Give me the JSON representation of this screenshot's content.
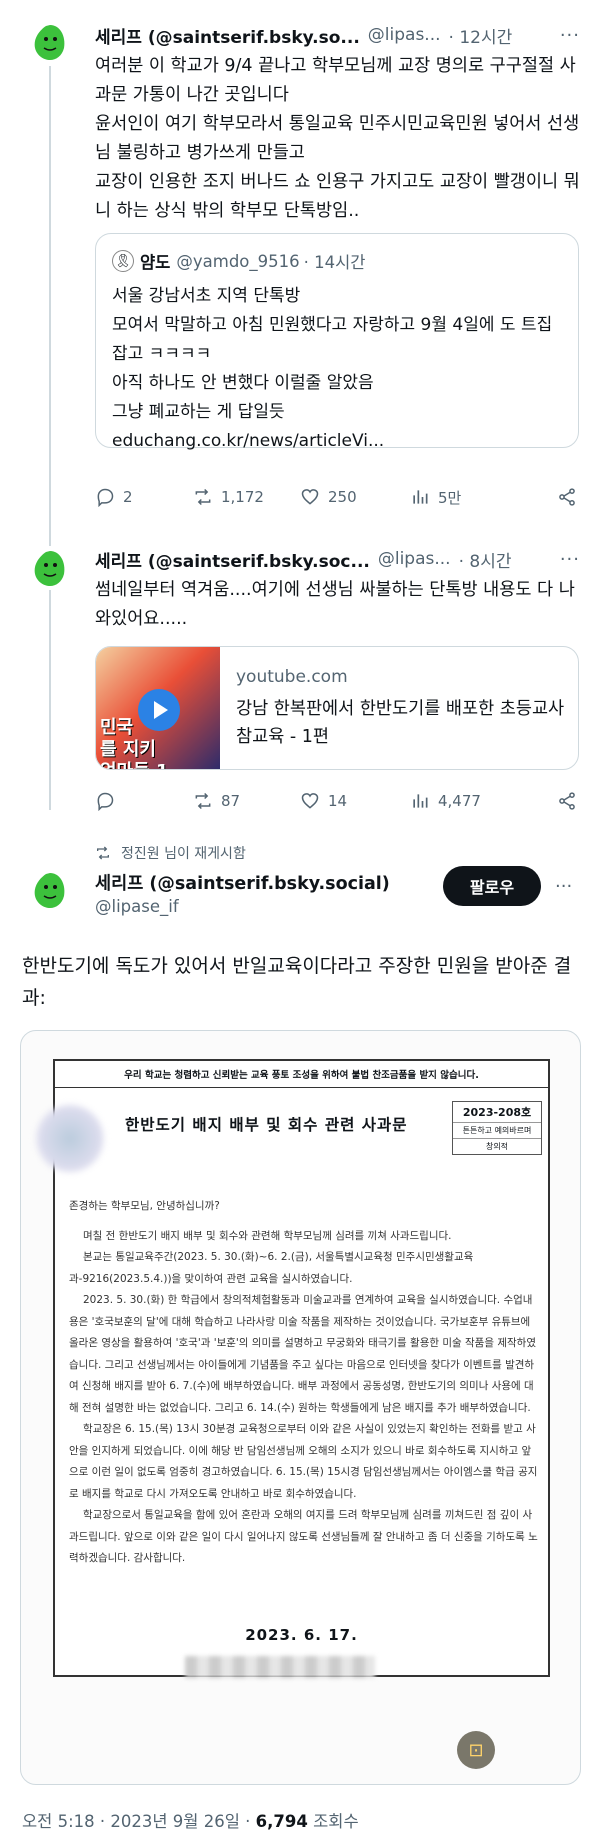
{
  "posts": [
    {
      "name": "세리프 (@saintserif.bsky.so...",
      "handle": "@lipas...",
      "time": "· 12시간",
      "more": "···",
      "text": "여러분 이 학교가 9/4 끝나고 학부모님께 교장 명의로 구구절절 사과문 가통이 나간 곳입니다\n윤서인이 여기 학부모라서 통일교육 민주시민교육민원 넣어서 선생님 불링하고 병가쓰게 만들고\n교장이 인용한 조지 버나드 쇼 인용구 가지고도 교장이 빨갱이니 뭐니 하는 상식 밖의 학부모 단톡방임..",
      "quote": {
        "icon": "🎗",
        "name": "얌도",
        "handle": "@yamdo_9516",
        "time": "· 14시간",
        "text": "서울 강남서초 지역 단톡방\n모여서 막말하고 아침 민원했다고 자랑하고 9월 4일에 도 트집 잡고 ㅋㅋㅋㅋ\n아직 하나도 안 변했다 이럴줄 알았음\n그냥 폐교하는 게 답일듯\neduchang.co.kr/news/articleVi..."
      },
      "stats": {
        "replies": "2",
        "reposts": "1,172",
        "likes": "250",
        "views": "5만"
      }
    },
    {
      "name": "세리프 (@saintserif.bsky.soc...",
      "handle": "@lipas...",
      "time": "· 8시간",
      "more": "···",
      "text": "썸네일부터 역겨움....여기에 선생님 싸불하는 단톡방 내용도 다 나와있어요.....",
      "link": {
        "thumb_caption": "민국\n를 지키\n엄마들 1",
        "domain": "youtube.com",
        "title": "강남 한복판에서 한반도기를 배포한 초등교사 참교육 - 1편"
      },
      "stats": {
        "replies": "",
        "reposts": "87",
        "likes": "14",
        "views": "4,477"
      }
    }
  ],
  "repost_label": "정진원 님이 재게시함",
  "main": {
    "name": "세리프 (@saintserif.bsky.social)",
    "handle": "@lipase_if",
    "follow_label": "팔로우",
    "more": "···",
    "text": "한반도기에 독도가 있어서 반일교육이다라고 주장한 민원을 받아준 결과:",
    "doc": {
      "top": "우리 학교는 청렴하고 신뢰받는 교육 풍토 조성을 위하여 불법 찬조금품을 받지 않습니다.",
      "title": "한반도기 배지 배부 및 회수 관련 사과문",
      "num": "2023-208호",
      "num_sub1": "튼튼하고 예의바르며",
      "num_sub2": "창의적",
      "greeting": "존경하는 학부모님, 안녕하십니까?",
      "p1": "며칠 전 한반도기 배지 배부 및 회수와 관련해 학부모님께 심려를 끼쳐 사과드립니다.",
      "p2": "본교는 통일교육주간(2023. 5. 30.(화)~6. 2.(금), 서울특별시교육청 민주시민생활교육과-9216(2023.5.4.))을 맞이하여 관련 교육을 실시하였습니다.",
      "p3": "2023. 5. 30.(화) 한 학급에서 창의적체험활동과 미술교과를 연계하여 교육을 실시하였습니다. 수업내용은 '호국보훈의 달'에 대해 학습하고 나라사랑 미술 작품을 제작하는 것이었습니다. 국가보훈부 유튜브에 올라온 영상을 활용하여 '호국'과 '보훈'의 의미를 설명하고 무궁화와 태극기를 활용한 미술 작품을 제작하였습니다. 그리고 선생님께서는 아이들에게 기념품을 주고 싶다는 마음으로 인터넷을 찾다가 이벤트를 발견하여 신청해 배지를 받아 6. 7.(수)에 배부하였습니다. 배부 과정에서 공동성명, 한반도기의 의미나 사용에 대해 전혀 설명한 바는 없었습니다. 그리고 6. 14.(수) 원하는 학생들에게 남은 배지를 추가 배부하였습니다.",
      "p4": "학교장은 6. 15.(목) 13시 30분경 교육청으로부터 이와 같은 사실이 있었는지 확인하는 전화를 받고 사안을 인지하게 되었습니다. 이에 해당 반 담임선생님께 오해의 소지가 있으니 바로 회수하도록 지시하고 앞으로 이런 일이 없도록 엄중히 경고하였습니다. 6. 15.(목) 15시경 담임선생님께서는 아이엠스쿨 학급 공지로 배지를 학교로 다시 가져오도록 안내하고 바로 회수하였습니다.",
      "p5": "학교장으로서 통일교육을 함에 있어 혼란과 오해의 여지를 드려 학부모님께 심려를 끼쳐드린 점 깊이 사과드립니다. 앞으로 이와 같은 일이 다시 일어나지 않도록 선생님들께 잘 안내하고 좀 더 신중을 기하도록 노력하겠습니다. 감사합니다.",
      "date": "2023. 6. 17."
    },
    "footer_time": "오전 5:18 · 2023년 9월 26일 · ",
    "footer_views": "6,794",
    "footer_views_label": " 조회수"
  },
  "colors": {
    "accent_green": "#3cc13c",
    "text": "#0f1419",
    "muted": "#536471",
    "border": "#cfd9de"
  }
}
